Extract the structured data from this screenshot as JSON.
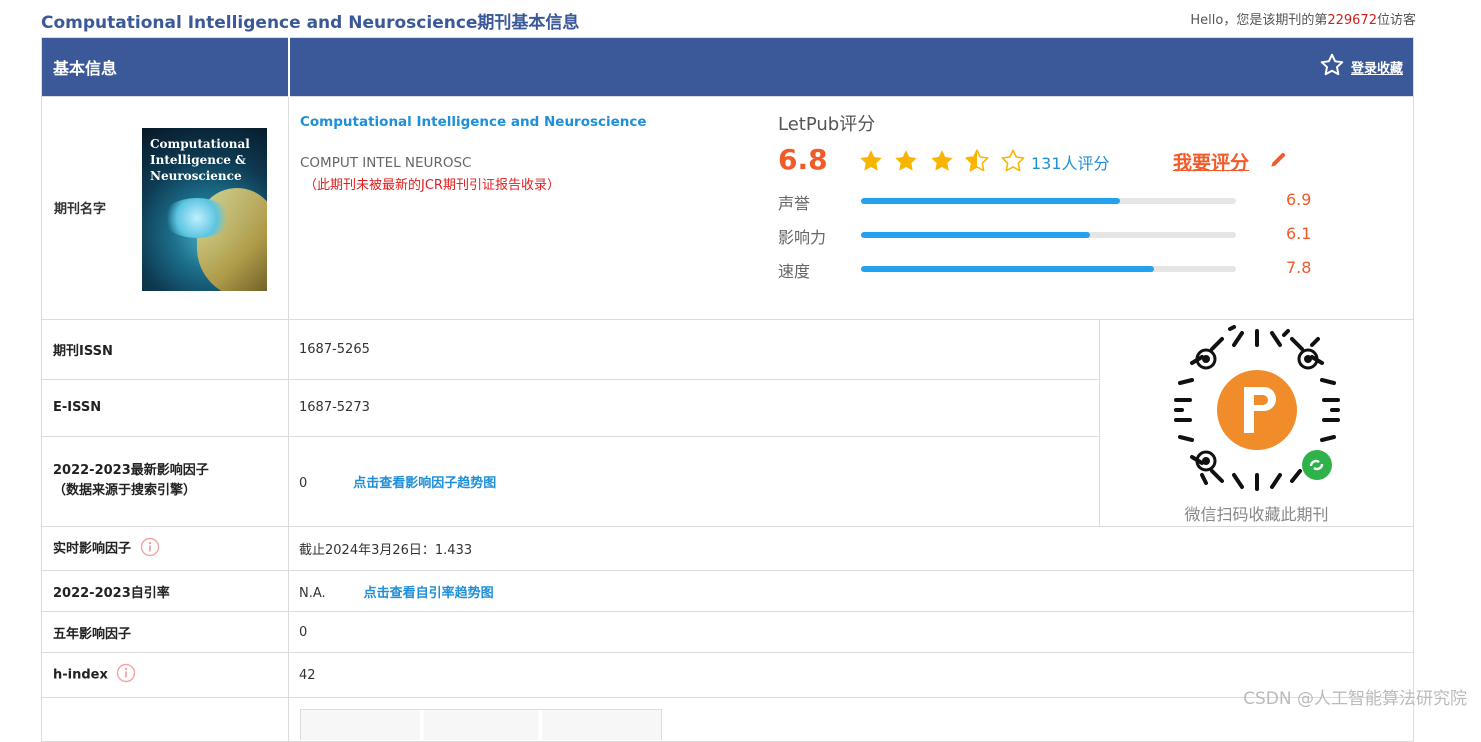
{
  "page": {
    "title": "Computational Intelligence and Neuroscience期刊基本信息",
    "visitor_prefix": "Hello，您是该期刊的第",
    "visitor_count": "229672",
    "visitor_suffix": "位访客"
  },
  "header": {
    "label": "基本信息",
    "favorite": "登录收藏"
  },
  "journal": {
    "name_label": "期刊名字",
    "cover_title": "Computational Intelligence & Neuroscience",
    "name": "Computational Intelligence and Neuroscience",
    "abbr": "COMPUT INTEL NEUROSC",
    "jcr_note": "（此期刊未被最新的JCR期刊引证报告收录）"
  },
  "rating": {
    "label": "LetPub评分",
    "score": "6.8",
    "stars": 3.5,
    "raters": "131人评分",
    "rate_link": "我要评分",
    "metrics": [
      {
        "label": "声誉",
        "value": "6.9",
        "fraction": 0.69
      },
      {
        "label": "影响力",
        "value": "6.1",
        "fraction": 0.61
      },
      {
        "label": "速度",
        "value": "7.8",
        "fraction": 0.78
      }
    ]
  },
  "rows": {
    "issn_label": "期刊ISSN",
    "issn": "1687-5265",
    "eissn_label": "E-ISSN",
    "eissn": "1687-5273",
    "if_label_1": "2022-2023最新影响因子",
    "if_label_2": "（数据来源于搜索引擎）",
    "if_value": "0",
    "if_link": "点击查看影响因子趋势图",
    "rt_label": "实时影响因子",
    "rt_value": "截止2024年3月26日：1.433",
    "self_label": "2022-2023自引率",
    "self_value": "N.A.",
    "self_link": "点击查看自引率趋势图",
    "five_label": "五年影响因子",
    "five_value": "0",
    "h_label": "h-index",
    "h_value": "42"
  },
  "qr": {
    "caption": "微信扫码收藏此期刊",
    "logo_text": "LetPub"
  },
  "watermark": "CSDN @人工智能算法研究院",
  "colors": {
    "header_bg": "#3b5998",
    "accent_orange": "#f25a2a",
    "link_blue": "#1f8fd8",
    "bar_blue": "#22a1ee"
  }
}
